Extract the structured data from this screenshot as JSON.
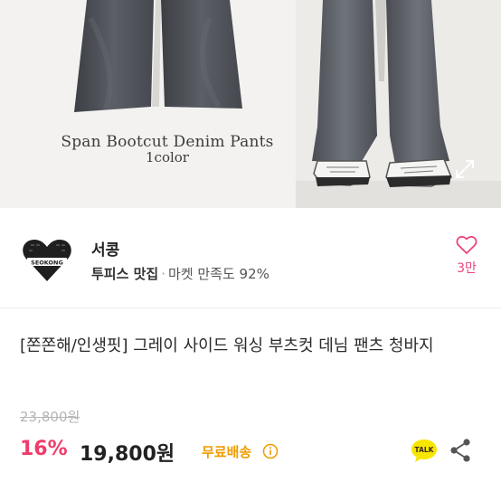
{
  "hero": {
    "title": "Span Bootcut Denim Pants",
    "subtitle": "1color",
    "expand_icon": "expand-icon"
  },
  "seller": {
    "logo_text": "SEOKONG",
    "name": "서콩",
    "tag": "투피스 맛집",
    "separator": "·",
    "satisfaction": "마켓 만족도 92%",
    "like_count": "3만",
    "like_icon": "heart-icon"
  },
  "product": {
    "title": "[쫀쫀해/인생핏] 그레이 사이드 워싱 부츠컷 데님 팬츠 청바지",
    "original_price": "23,800원",
    "discount": "16%",
    "price": "19,800원",
    "shipping": "무료배송",
    "talk_label": "TALK",
    "share_icon": "share-icon"
  },
  "colors": {
    "accent_pink": "#ef3d6b",
    "shipping_orange": "#ef9b00",
    "talk_yellow": "#f7e600"
  }
}
